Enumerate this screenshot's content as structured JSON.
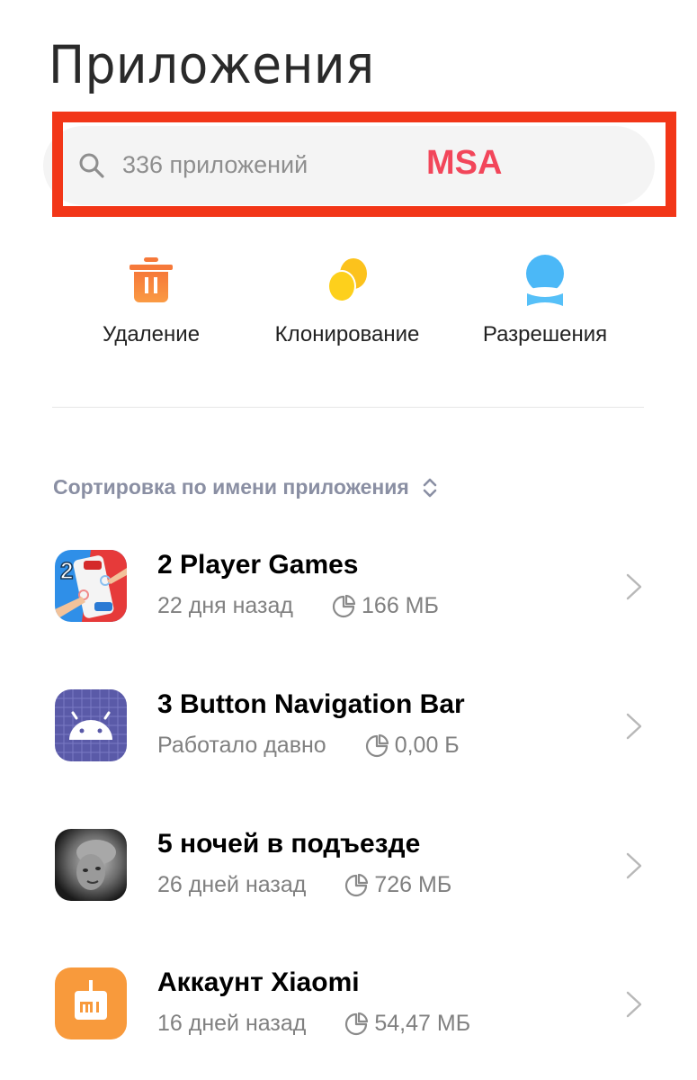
{
  "header": {
    "title": "Приложения"
  },
  "search": {
    "placeholder": "336 приложений",
    "icon": "search-icon"
  },
  "annotation": {
    "label": "MSA",
    "box_color": "#f23618",
    "label_color": "#f2465a"
  },
  "actions": [
    {
      "label": "Удаление",
      "icon": "trash-icon",
      "color": "#f7873a"
    },
    {
      "label": "Клонирование",
      "icon": "clone-icon",
      "color": "#fcc61c"
    },
    {
      "label": "Разрешения",
      "icon": "permissions-icon",
      "color": "#4bb8f7"
    }
  ],
  "sort": {
    "label": "Сортировка по имени приложения",
    "icon": "sort-toggle-icon"
  },
  "apps": [
    {
      "name": "2 Player Games",
      "last_used": "22 дня назад",
      "size": "166 МБ"
    },
    {
      "name": "3 Button Navigation Bar",
      "last_used": "Работало давно",
      "size": "0,00 Б"
    },
    {
      "name": "5 ночей в подъезде",
      "last_used": "26 дней назад",
      "size": "726 МБ"
    },
    {
      "name": "Аккаунт Xiaomi",
      "last_used": "16 дней назад",
      "size": "54,47 МБ"
    }
  ]
}
